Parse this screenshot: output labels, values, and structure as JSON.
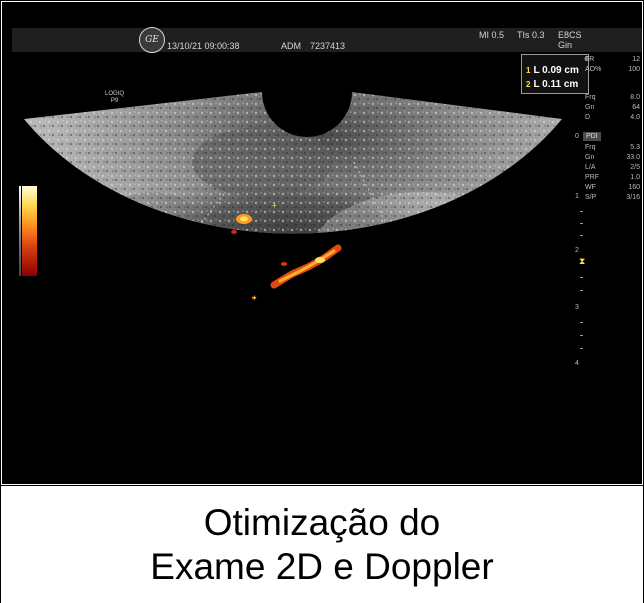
{
  "header": {
    "datetime": "13/10/21 09:00:38",
    "operator": "ADM",
    "patient_id": "7237413",
    "logo_icon": "ge-logo-icon",
    "logo_text": "GE"
  },
  "top_right": {
    "mi": "MI 0.5",
    "tis": "TIs 0.3",
    "probe": "E8CS",
    "preset": "Gin"
  },
  "system_label": {
    "line1": "LOGIQ",
    "line2": "P9"
  },
  "measurements": [
    {
      "index": "1",
      "text": "L 0.09 cm"
    },
    {
      "index": "2",
      "text": "L 0.11 cm"
    }
  ],
  "params_top": [
    {
      "label": "FR",
      "value": "12"
    },
    {
      "label": "AO%",
      "value": "100"
    },
    {
      "label": "Frq",
      "value": "8.0"
    },
    {
      "label": "Gn",
      "value": "64"
    },
    {
      "label": "D",
      "value": "4.0"
    }
  ],
  "pdi": {
    "label": "PDI",
    "params": [
      {
        "label": "Frq",
        "value": "5.3"
      },
      {
        "label": "Gn",
        "value": "33.0"
      },
      {
        "label": "L/A",
        "value": "2/5"
      },
      {
        "label": "PRF",
        "value": "1.0"
      },
      {
        "label": "WF",
        "value": "160"
      },
      {
        "label": "S/P",
        "value": "3/16"
      }
    ]
  },
  "depth_scale": [
    "0",
    "1",
    "2",
    "3",
    "4"
  ],
  "colors": {
    "background": "#000000",
    "doppler_hot": "#ff8a1c",
    "marker_yellow": "#ffe23a"
  },
  "caption": {
    "line1": "Otimização do",
    "line2": "Exame 2D e Doppler"
  }
}
